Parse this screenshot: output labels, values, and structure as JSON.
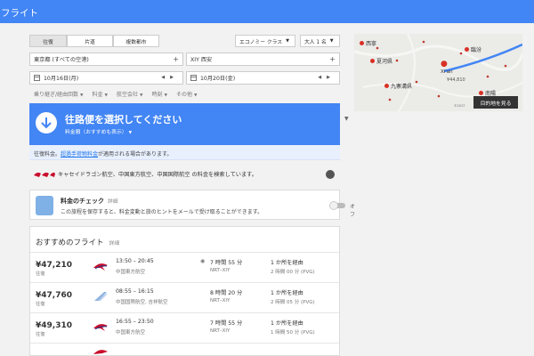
{
  "header": {
    "title": "フライト"
  },
  "trip_type": {
    "options": [
      "往復",
      "片道",
      "複数都市"
    ],
    "selected": "往復"
  },
  "cabin": {
    "value": "エコノミー クラス"
  },
  "passengers": {
    "value": "大人 1 名"
  },
  "origin": {
    "value": "東京都 (すべての空港)"
  },
  "destination": {
    "value": "XIY 西安"
  },
  "depart_date": {
    "value": "10月16日(月)"
  },
  "return_date": {
    "value": "10月20日(金)"
  },
  "filters": [
    "乗り継ぎ/経由回数",
    "料金",
    "航空会社",
    "時刻",
    "その他"
  ],
  "select_card": {
    "title": "往路便を選択してください",
    "sort": "料金順（おすすめも表示）",
    "notice_prefix": "往復料金。",
    "notice_link": "超過手荷物料金",
    "notice_suffix": "が適用される場合があります。"
  },
  "searching": {
    "text": "キャセイドラゴン航空、中国東方航空、中国国際航空 の料金を検索しています。"
  },
  "price_check": {
    "title": "料金のチェック",
    "detail": "詳細",
    "description": "この旅程を保存すると、料金変動と旅のヒントをメールで受け取ることができます。",
    "toggle_label": "オフ"
  },
  "recommended": {
    "title": "おすすめのフライト",
    "detail": "詳細",
    "flights": [
      {
        "price": "¥47,210",
        "type": "往復",
        "time": "13:50 – 20:45",
        "airline": "中国東方航空",
        "duration": "7 時間 55 分",
        "route": "NRT–XIY",
        "stops": "1 か所を経由",
        "layover": "2 時間 00 分 (PVG)",
        "wifi": true
      },
      {
        "price": "¥47,760",
        "type": "往復",
        "time": "08:55 – 16:15",
        "airline": "中国国際航空, 吉祥航空",
        "duration": "8 時間 20 分",
        "route": "NRT–XIY",
        "stops": "1 か所を経由",
        "layover": "2 時間 05 分 (PVG)",
        "wifi": false
      },
      {
        "price": "¥49,310",
        "type": "往復",
        "time": "16:55 – 23:50",
        "airline": "中国東方航空",
        "duration": "7 時間 55 分",
        "route": "NRT–XIY",
        "stops": "1 か所を経由",
        "layover": "1 時間 50 分 (PVG)",
        "wifi": false
      }
    ]
  },
  "map": {
    "labels": [
      "西寧",
      "夏河県",
      "臨汾",
      "九寨溝県",
      "Xi'an",
      "南陽"
    ],
    "price": "¥44,810",
    "button": "目的地を見る",
    "copyright": "©2017"
  },
  "colors": {
    "accent": "#4285f4",
    "pin": "#d93025"
  }
}
